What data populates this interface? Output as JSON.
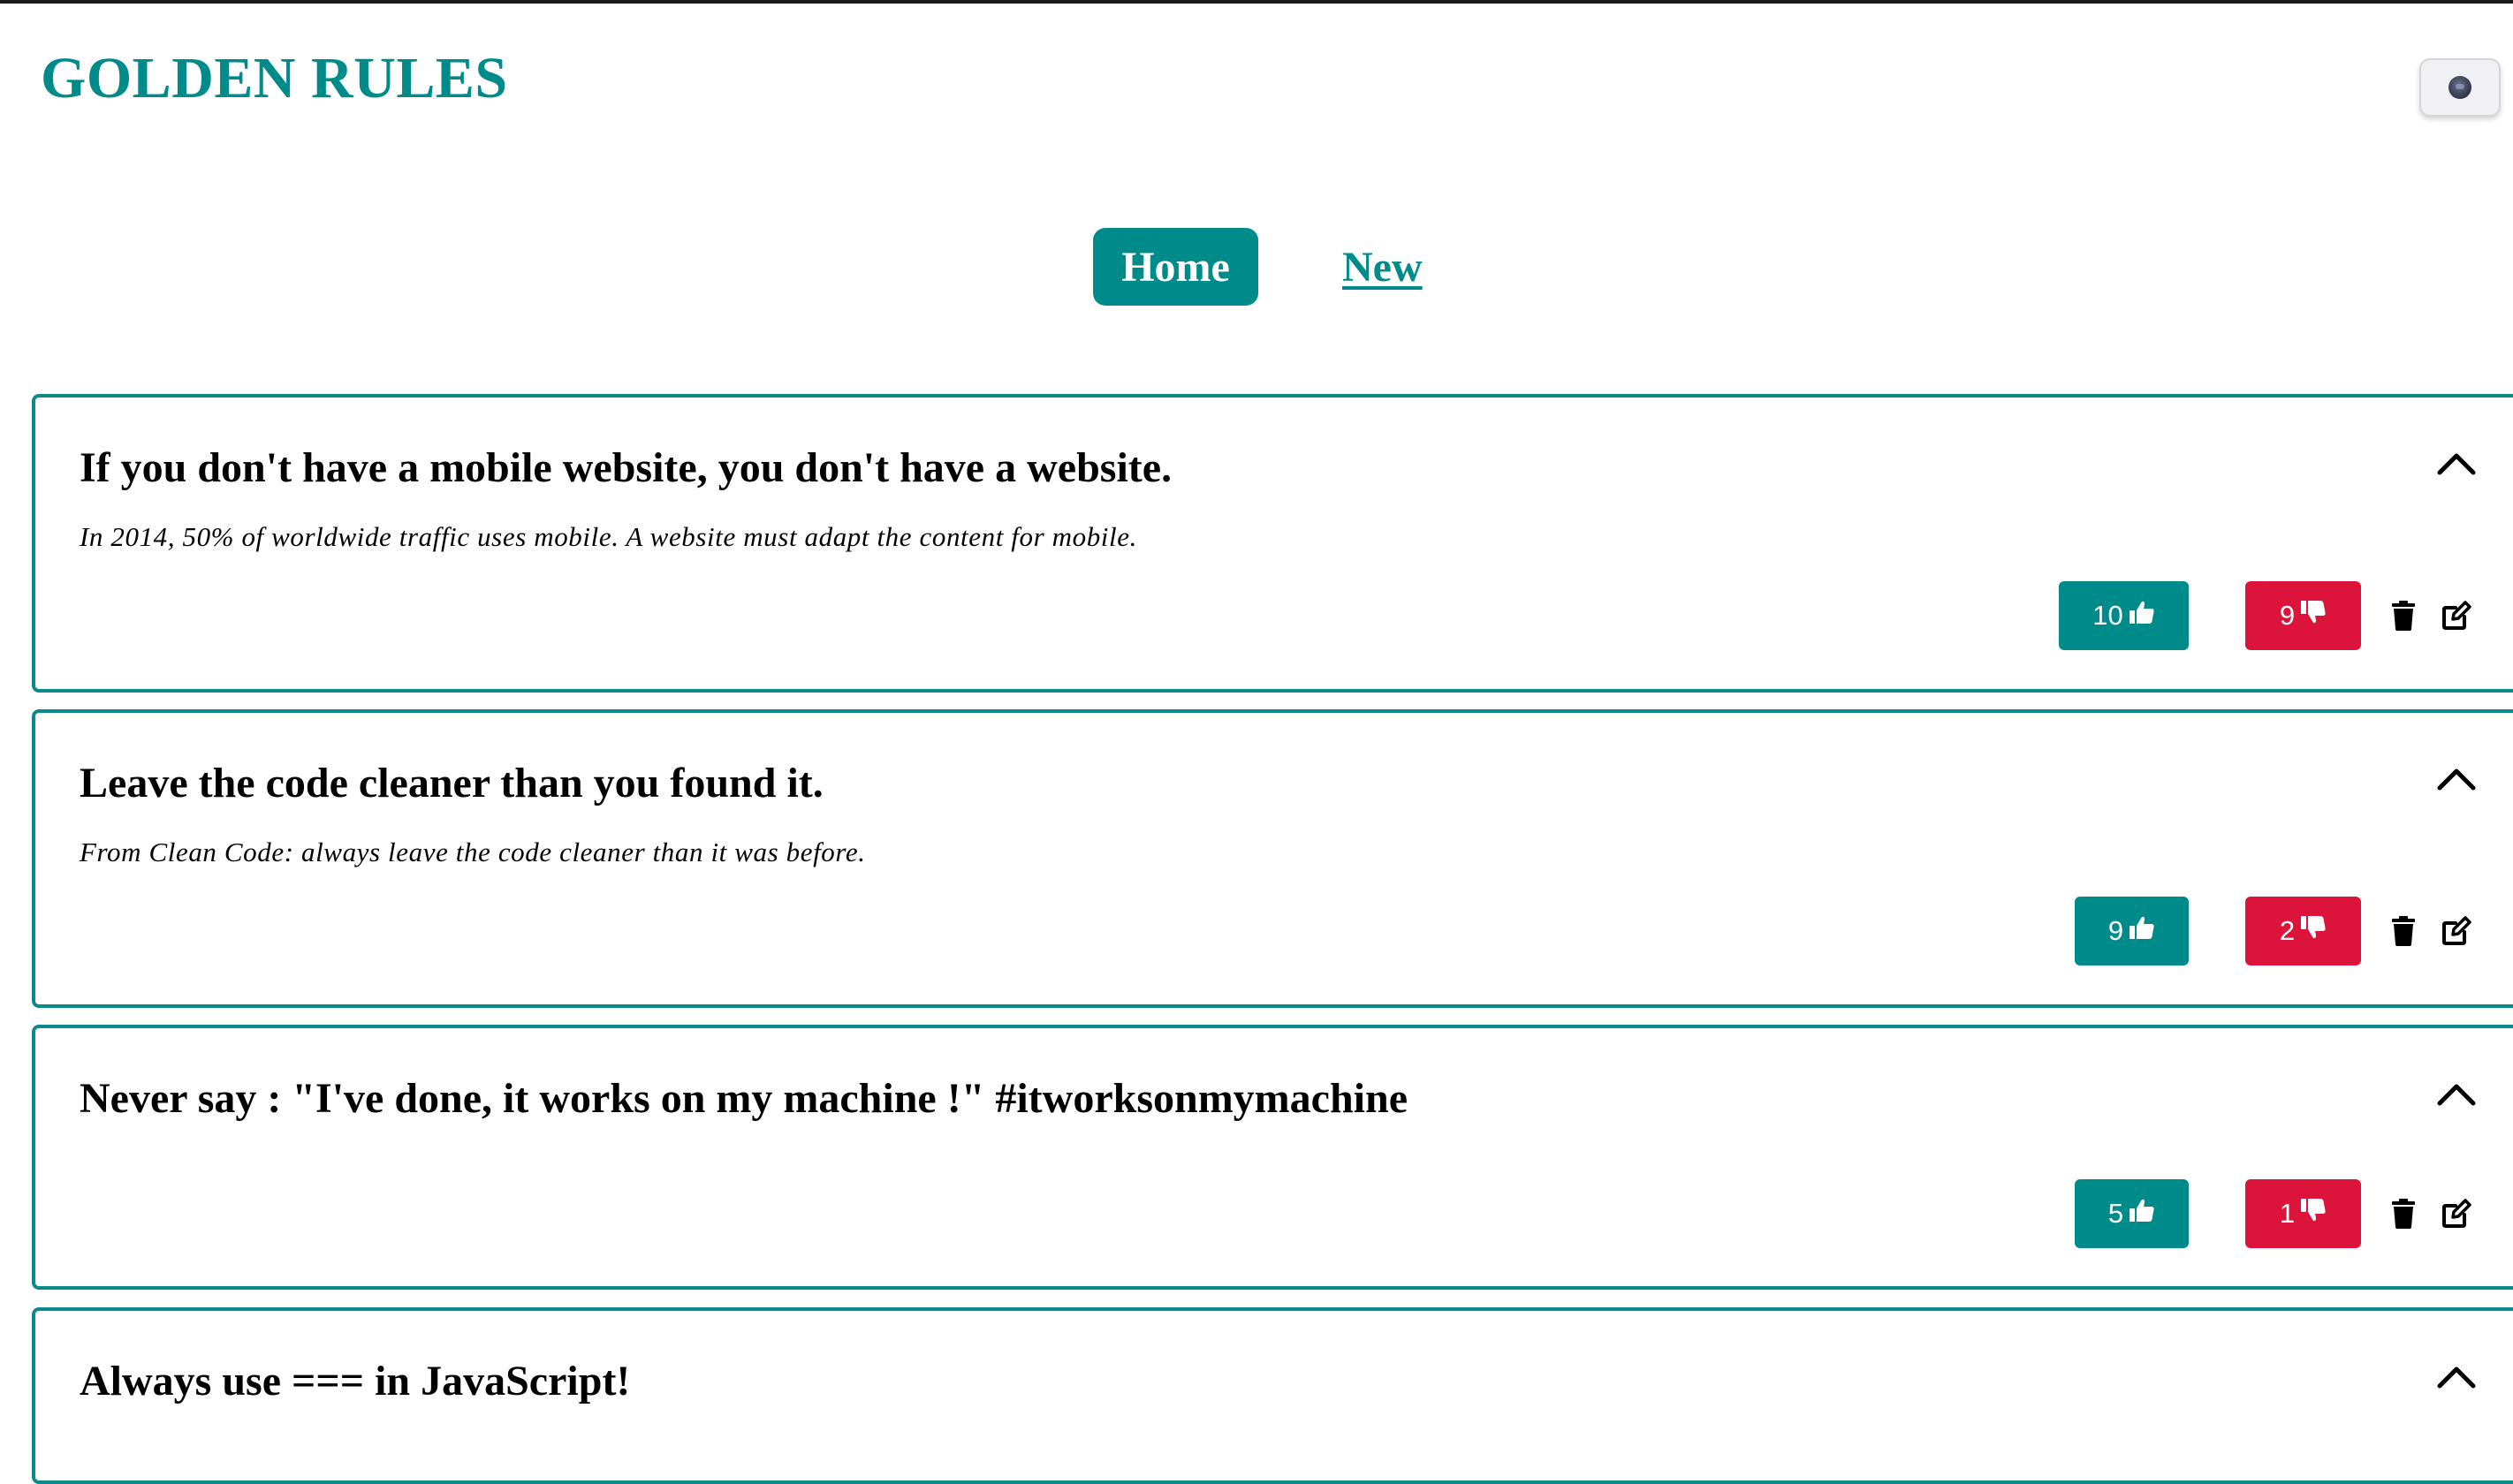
{
  "app": {
    "title": "GOLDEN RULES",
    "theme_toggle_icon": "dark-mode-toggle-icon"
  },
  "nav": {
    "home_label": "Home",
    "new_label": "New",
    "active": "Home"
  },
  "colors": {
    "accent": "#008b8b",
    "like": "#008b8b",
    "dislike": "#dc143c"
  },
  "rules": [
    {
      "title": "If you don't have a mobile website, you don't have a website.",
      "description": "In 2014, 50% of worldwide traffic uses mobile. A website must adapt the content for mobile.",
      "likes": "10",
      "dislikes": "9"
    },
    {
      "title": "Leave the code cleaner than you found it.",
      "description": "From Clean Code: always leave the code cleaner than it was before.",
      "likes": "9",
      "dislikes": "2"
    },
    {
      "title": "Never say : \"I've done, it works on my machine !\" #itworksonmymachine",
      "description": "",
      "likes": "5",
      "dislikes": "1"
    },
    {
      "title": "Always use === in JavaScript!",
      "description": "",
      "likes": "",
      "dislikes": ""
    }
  ]
}
